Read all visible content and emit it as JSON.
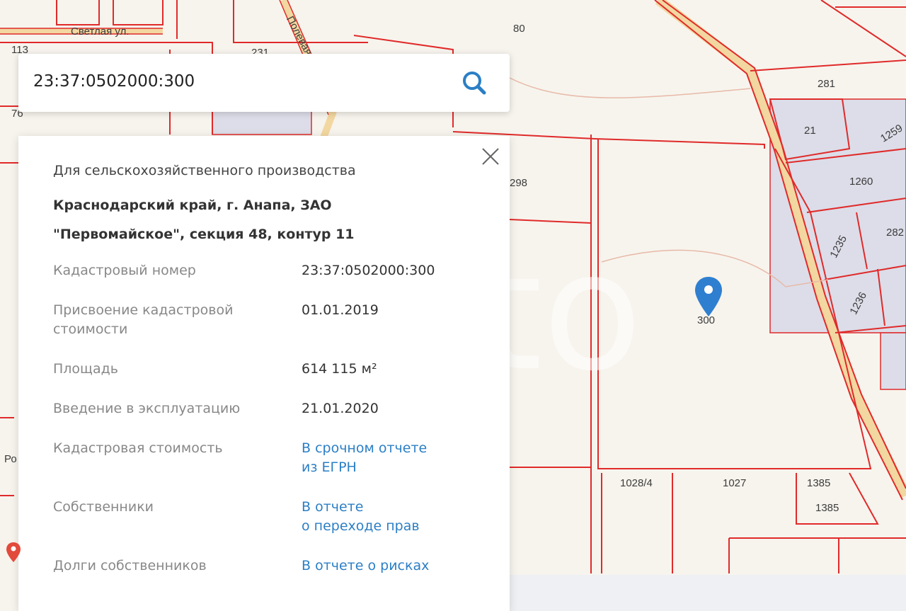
{
  "map": {
    "street_labels": [
      "Светлая ул.",
      "Полевая"
    ],
    "parcel_labels": [
      "80",
      "113",
      "76",
      "231",
      "281",
      "21",
      "1259",
      "298",
      "1260",
      "1235",
      "282",
      "1236",
      "1028/4",
      "1027",
      "1385",
      "1385",
      "Ро"
    ],
    "selected_parcel_label": "300",
    "colors": {
      "background": "#f7f4ed",
      "parcel_border": "#e02a2a",
      "road": "#f3d7a0",
      "building": "#dcdde8"
    }
  },
  "search": {
    "value": "23:37:0502000:300",
    "icon": "search-icon"
  },
  "info": {
    "purpose": "Для сельскохозяйственного производства",
    "address_line1": "Краснодарский край, г. Анапа, ЗАО",
    "address_line2": "\"Первомайское\", секция 48, контур 11",
    "rows": [
      {
        "label": "Кадастровый номер",
        "value": "23:37:0502000:300"
      },
      {
        "label_line1": "Присвоение кадастровой",
        "label_line2": "стоимости",
        "value": "01.01.2019"
      },
      {
        "label": "Площадь",
        "value": "614 115 м²"
      },
      {
        "label": "Введение в эксплуатацию",
        "value": "21.01.2020"
      },
      {
        "label": "Кадастровая стоимость",
        "link_line1": "В срочном отчете",
        "link_line2": "из ЕГРН"
      },
      {
        "label": "Собственники",
        "link_line1": "В отчете",
        "link_line2": "о переходе прав"
      },
      {
        "label": "Долги собственников",
        "link": "В отчете о рисках"
      }
    ]
  },
  "colors": {
    "link": "#2b7fc5",
    "pin": "#2f7fd0"
  }
}
